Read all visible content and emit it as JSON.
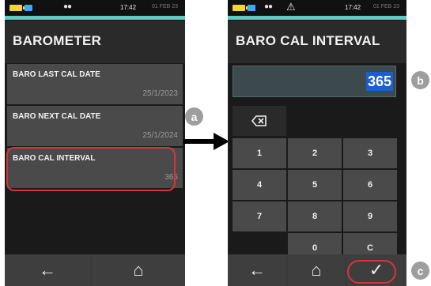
{
  "left_screen": {
    "status": {
      "time": "17:42",
      "date": "01 FEB 23"
    },
    "title": "BAROMETER",
    "rows": [
      {
        "label": "BARO LAST CAL DATE",
        "value": "25/1/2023"
      },
      {
        "label": "BARO NEXT CAL DATE",
        "value": "25/1/2024"
      },
      {
        "label": "BARO CAL INTERVAL",
        "value": "365"
      }
    ],
    "nav": {
      "back": "←",
      "home": "⌂"
    }
  },
  "right_screen": {
    "status": {
      "time": "17:42",
      "date": "01 FEB 23"
    },
    "title": "BARO CAL INTERVAL",
    "input_value": "365",
    "keypad": [
      [
        "1",
        "2",
        "3"
      ],
      [
        "4",
        "5",
        "6"
      ],
      [
        "7",
        "8",
        "9"
      ],
      [
        "",
        "0",
        "C"
      ]
    ],
    "nav": {
      "back": "←",
      "home": "⌂",
      "confirm": "✓"
    }
  },
  "callouts": {
    "a": "a",
    "b": "b",
    "c": "c"
  },
  "colors": {
    "teal": "#5fc9c2",
    "highlight_red": "#d9333a",
    "selection_blue": "#1a5fd0"
  }
}
